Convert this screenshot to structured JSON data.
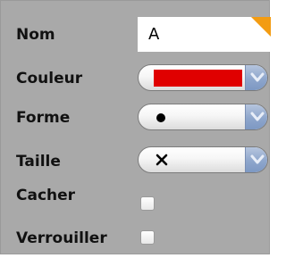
{
  "properties": {
    "name": {
      "label": "Nom",
      "value": "A"
    },
    "color": {
      "label": "Couleur",
      "value_color": "#e00000"
    },
    "shape": {
      "label": "Forme",
      "icon": "filled-circle"
    },
    "size": {
      "label": "Taille",
      "icon": "cross"
    },
    "hide": {
      "label": "Cacher",
      "checked": false
    },
    "lock": {
      "label": "Verrouiller",
      "checked": false
    }
  },
  "colors": {
    "panel_background": "#a9a9a9",
    "accent_corner": "#f39c12",
    "dropdown_button": "#8ea6cc"
  }
}
